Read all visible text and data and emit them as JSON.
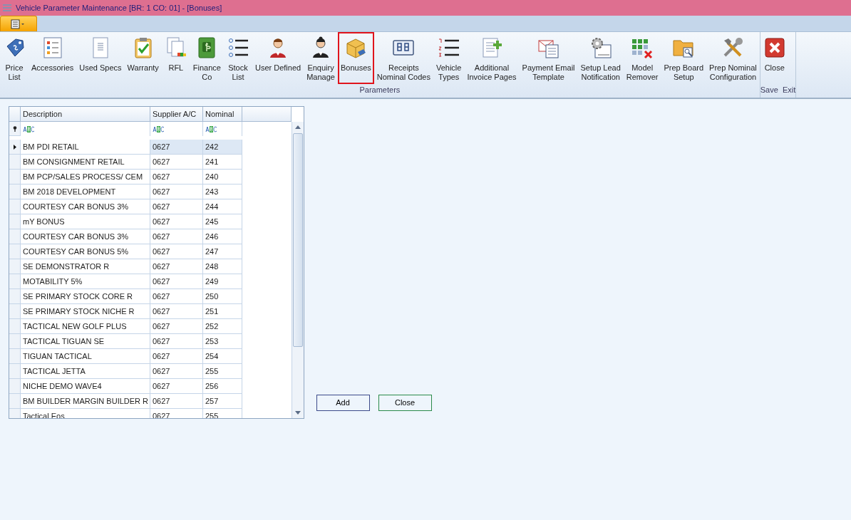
{
  "window": {
    "title": "Vehicle Parameter Maintenance [BR: 1 CO: 01] - [Bonuses]"
  },
  "ribbon": {
    "groups": [
      {
        "caption": "Parameters",
        "items": [
          {
            "label": [
              "Price",
              "List"
            ],
            "highlighted": false
          },
          {
            "label": [
              "Accessories"
            ],
            "highlighted": false
          },
          {
            "label": [
              "Used Specs"
            ],
            "highlighted": false
          },
          {
            "label": [
              "Warranty"
            ],
            "highlighted": false
          },
          {
            "label": [
              "RFL"
            ],
            "highlighted": false
          },
          {
            "label": [
              "Finance",
              "Co"
            ],
            "highlighted": false
          },
          {
            "label": [
              "Stock",
              "List"
            ],
            "highlighted": false
          },
          {
            "label": [
              "User Defined"
            ],
            "highlighted": false
          },
          {
            "label": [
              "Enquiry",
              "Manage"
            ],
            "highlighted": false
          },
          {
            "label": [
              "Bonuses"
            ],
            "highlighted": true
          },
          {
            "label": [
              "Receipts",
              "Nominal Codes"
            ],
            "highlighted": false
          },
          {
            "label": [
              "Vehicle",
              "Types"
            ],
            "highlighted": false
          },
          {
            "label": [
              "Additional",
              "Invoice Pages"
            ],
            "highlighted": false
          },
          {
            "label": [
              "Payment Email",
              "Template"
            ],
            "highlighted": false
          },
          {
            "label": [
              "Setup Lead",
              "Notification"
            ],
            "highlighted": false
          },
          {
            "label": [
              "Model",
              "Remover"
            ],
            "highlighted": false
          },
          {
            "label": [
              "Prep Board",
              "Setup"
            ],
            "highlighted": false
          },
          {
            "label": [
              "Prep Nominal",
              "Configuration"
            ],
            "highlighted": false
          }
        ]
      },
      {
        "caption": "Save  Exit",
        "items": [
          {
            "label": [
              "Close"
            ],
            "highlighted": false
          }
        ]
      }
    ]
  },
  "table": {
    "columns": [
      "Description",
      "Supplier A/C",
      "Nominal"
    ],
    "rows": [
      {
        "cells": [
          "BM PDI RETAIL",
          "0627",
          "242"
        ],
        "selected": true
      },
      {
        "cells": [
          "BM CONSIGNMENT RETAIL",
          "0627",
          "241"
        ],
        "selected": false
      },
      {
        "cells": [
          "BM PCP/SALES PROCESS/ CEM",
          "0627",
          "240"
        ],
        "selected": false
      },
      {
        "cells": [
          "BM 2018 DEVELOPMENT",
          "0627",
          "243"
        ],
        "selected": false
      },
      {
        "cells": [
          "COURTESY CAR BONUS 3%",
          "0627",
          "244"
        ],
        "selected": false
      },
      {
        "cells": [
          "mY BONUS",
          "0627",
          "245"
        ],
        "selected": false
      },
      {
        "cells": [
          "COURTESY CAR BONUS 3%",
          "0627",
          "246"
        ],
        "selected": false
      },
      {
        "cells": [
          "COURTESY CAR BONUS 5%",
          "0627",
          "247"
        ],
        "selected": false
      },
      {
        "cells": [
          "SE DEMONSTRATOR R",
          "0627",
          "248"
        ],
        "selected": false
      },
      {
        "cells": [
          "MOTABILITY 5%",
          "0627",
          "249"
        ],
        "selected": false
      },
      {
        "cells": [
          "SE PRIMARY STOCK CORE R",
          "0627",
          "250"
        ],
        "selected": false
      },
      {
        "cells": [
          "SE PRIMARY STOCK NICHE R",
          "0627",
          "251"
        ],
        "selected": false
      },
      {
        "cells": [
          "TACTICAL NEW GOLF PLUS",
          "0627",
          "252"
        ],
        "selected": false
      },
      {
        "cells": [
          "TACTICAL TIGUAN SE",
          "0627",
          "253"
        ],
        "selected": false
      },
      {
        "cells": [
          "TIGUAN TACTICAL",
          "0627",
          "254"
        ],
        "selected": false
      },
      {
        "cells": [
          "TACTICAL JETTA",
          "0627",
          "255"
        ],
        "selected": false
      },
      {
        "cells": [
          "NICHE DEMO WAVE4",
          "0627",
          "256"
        ],
        "selected": false
      },
      {
        "cells": [
          "BM BUILDER MARGIN BUILDER R",
          "0627",
          "257"
        ],
        "selected": false
      },
      {
        "cells": [
          "Tactical Eos",
          "0627",
          "255"
        ],
        "selected": false
      }
    ]
  },
  "buttons": [
    "Add",
    "Close"
  ]
}
